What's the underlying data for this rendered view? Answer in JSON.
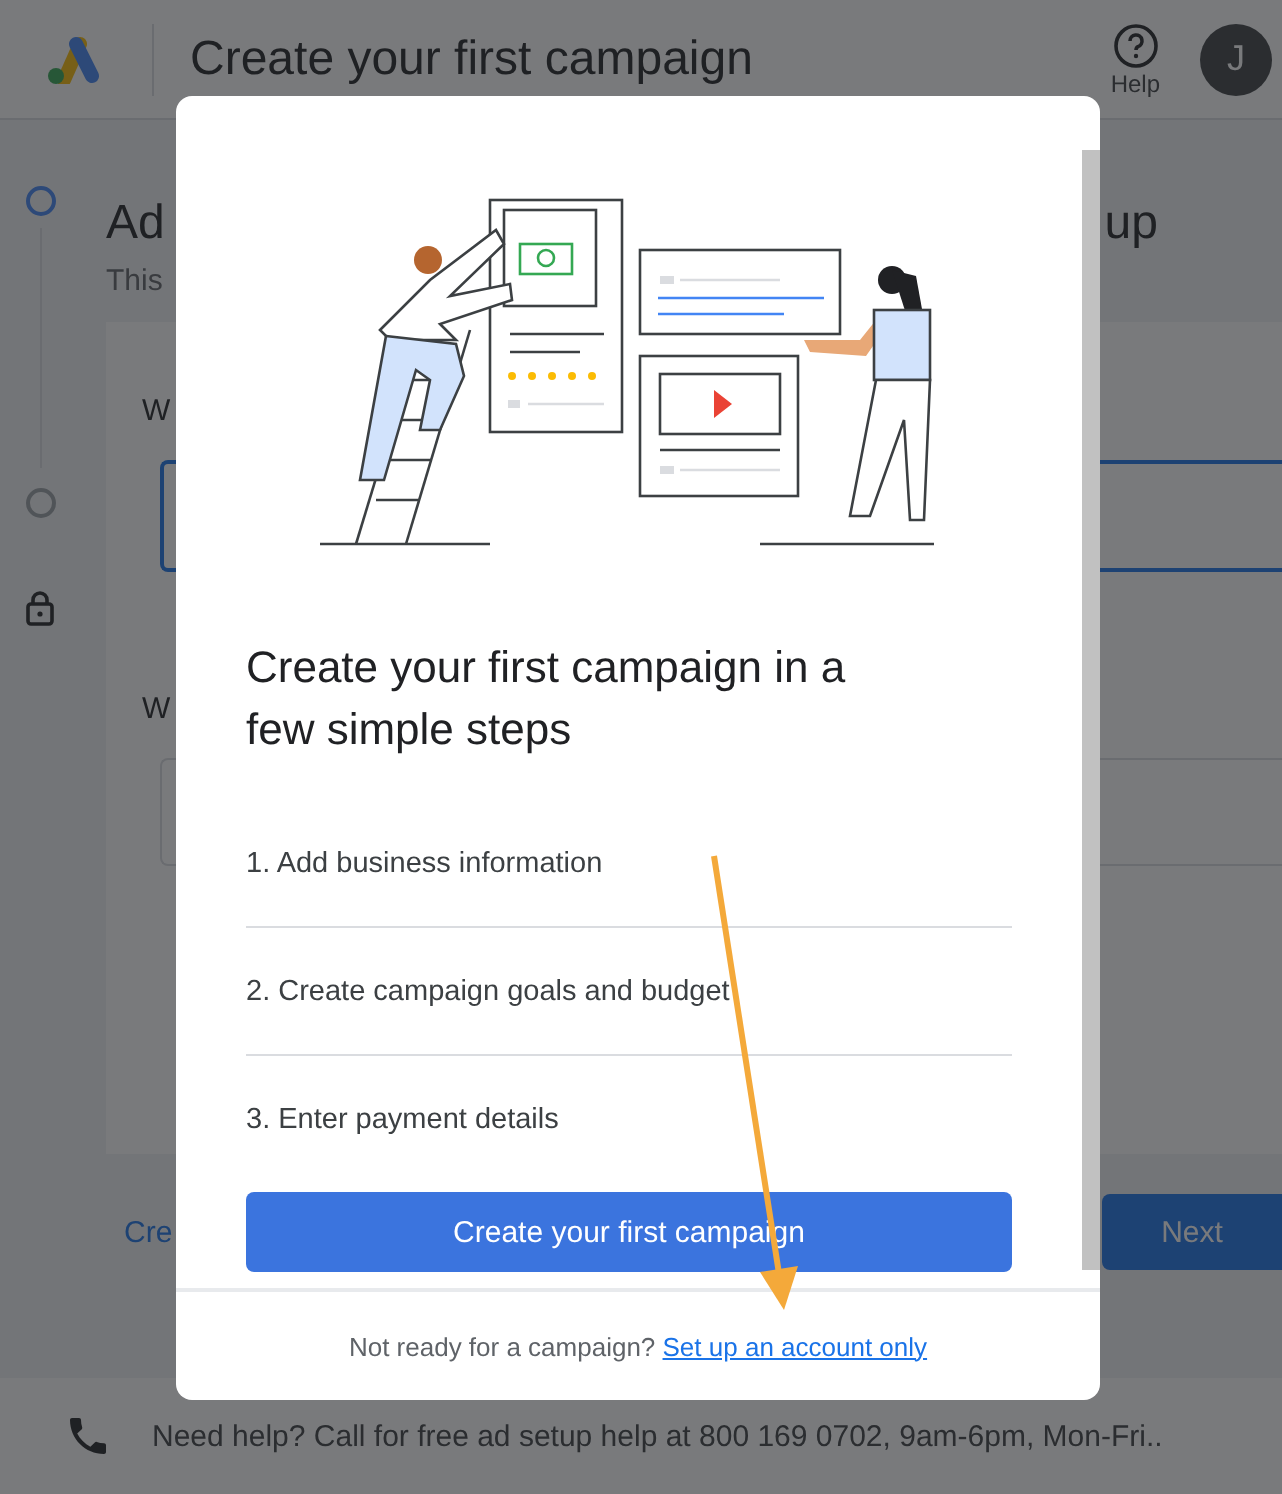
{
  "app_header": {
    "title": "Create your first campaign",
    "help_label": "Help",
    "avatar_initial": "J"
  },
  "stepper": [
    {
      "kind": "circle",
      "selected": true
    },
    {
      "kind": "circle",
      "selected": false
    },
    {
      "kind": "lock"
    }
  ],
  "page": {
    "heading_start": "Ad",
    "heading_end": "up",
    "subtitle": "This",
    "fields": [
      {
        "label": "W",
        "focused": true
      },
      {
        "label": "W",
        "focused": false
      }
    ],
    "link": "Cre",
    "next_button": "Next"
  },
  "help_bar": {
    "text": "Need help? Call for free ad setup help at 800 169 0702, 9am-6pm, Mon-Fri.."
  },
  "dialog": {
    "heading": "Create your first campaign in a few simple steps",
    "steps": [
      "1. Add business information",
      "2. Create campaign goals and budget",
      "3. Enter payment details"
    ],
    "primary_button": "Create your first campaign",
    "footer_text": "Not ready for a campaign?",
    "footer_link": "Set up an account only"
  }
}
